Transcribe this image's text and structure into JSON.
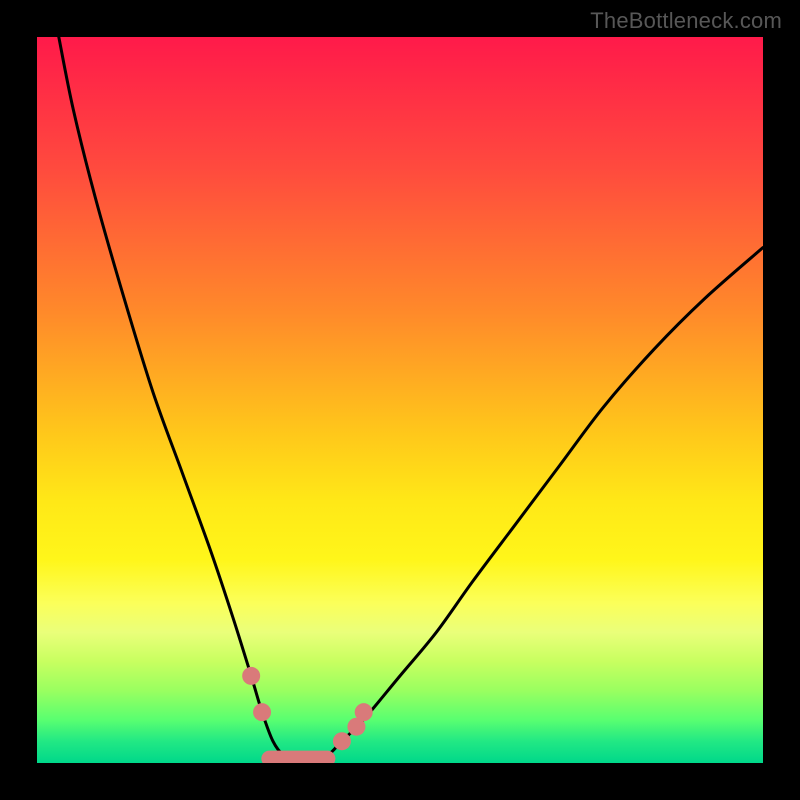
{
  "watermark": "TheBottleneck.com",
  "chart_data": {
    "type": "line",
    "title": "",
    "xlabel": "",
    "ylabel": "",
    "xlim": [
      0,
      100
    ],
    "ylim": [
      0,
      100
    ],
    "series": [
      {
        "name": "bottleneck-curve",
        "x": [
          3,
          5,
          8,
          12,
          16,
          20,
          24,
          27,
          29.5,
          31,
          32.5,
          34,
          36,
          38,
          40,
          42,
          45,
          50,
          55,
          60,
          66,
          72,
          78,
          85,
          92,
          100
        ],
        "values": [
          100,
          90,
          78,
          64,
          51,
          40,
          29,
          20,
          12,
          7,
          3,
          1,
          0,
          0,
          1,
          3,
          6,
          12,
          18,
          25,
          33,
          41,
          49,
          57,
          64,
          71
        ]
      }
    ],
    "markers": [
      {
        "name": "left-upper-dot",
        "x": 29.5,
        "y": 12
      },
      {
        "name": "left-lower-dot",
        "x": 31,
        "y": 7
      },
      {
        "name": "right-lower-dot",
        "x": 42,
        "y": 3
      },
      {
        "name": "right-mid-dot",
        "x": 44,
        "y": 5
      },
      {
        "name": "right-upper-dot",
        "x": 45,
        "y": 7
      }
    ],
    "bottom_segment": {
      "x_start": 32,
      "x_end": 40,
      "y": 0.6
    },
    "marker_color": "#d97a7a",
    "curve_color": "#000000"
  }
}
